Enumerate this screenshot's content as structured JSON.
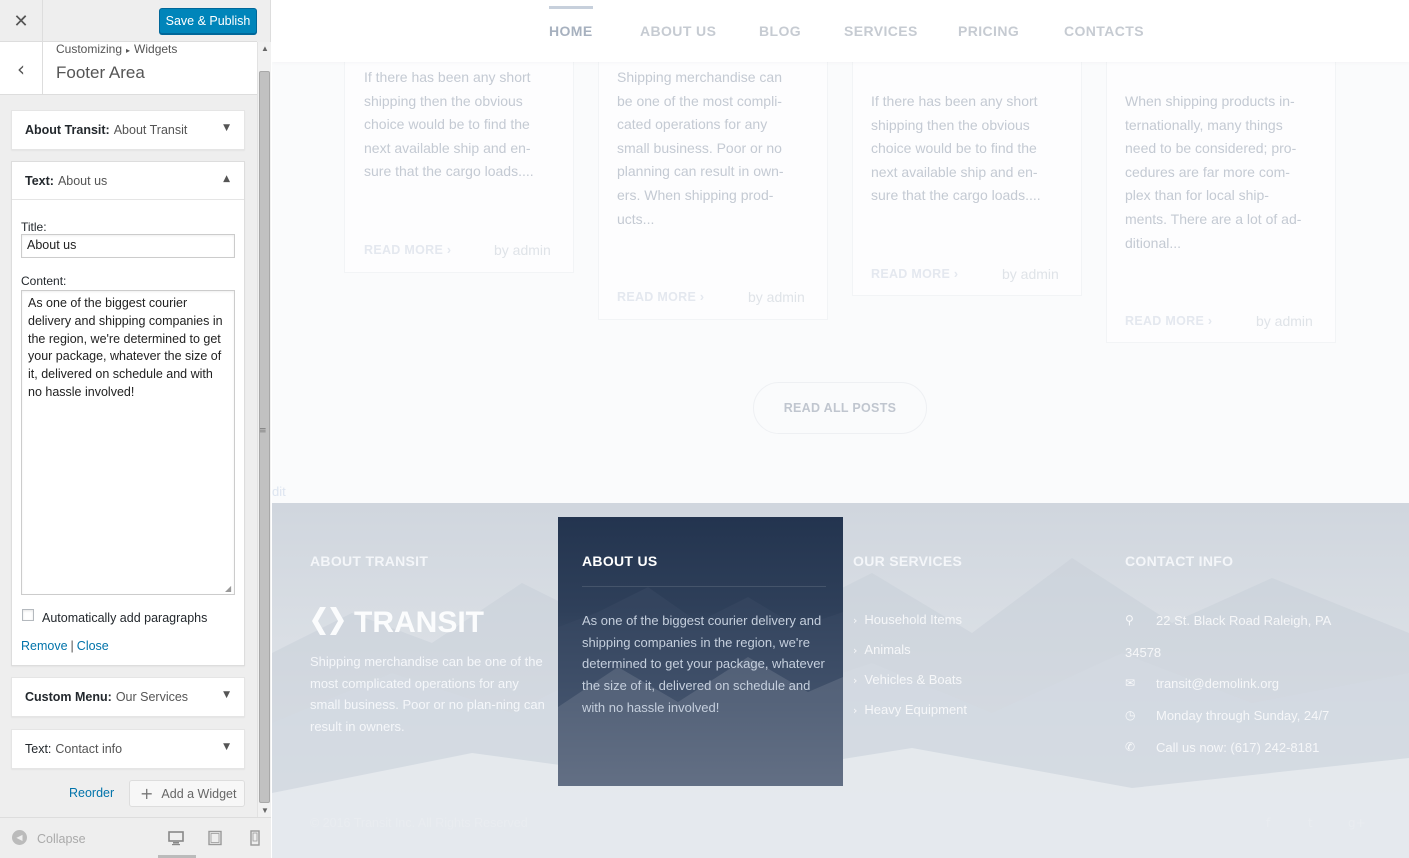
{
  "customizer": {
    "close_icon": "close-icon",
    "save_label": "Save & Publish",
    "breadcrumb": [
      "Customizing",
      "Widgets"
    ],
    "panel_title": "Footer Area",
    "widgets": [
      {
        "type": "About Transit:",
        "title": "About Transit",
        "expanded": false
      },
      {
        "type": "Text:",
        "title": "About us",
        "expanded": true
      },
      {
        "type": "Custom Menu:",
        "title": "Our Services",
        "expanded": false
      },
      {
        "type": "Text:",
        "title": "Contact info",
        "expanded": false
      }
    ],
    "form": {
      "title_label": "Title:",
      "title_value": "About us",
      "content_label": "Content:",
      "content_value": "As one of the biggest courier delivery and shipping companies in the region, we're determined to get your package, whatever the size of it, delivered on schedule and with no hassle involved!",
      "autop_label": "Automatically add paragraphs",
      "autop_checked": false,
      "remove_label": "Remove",
      "close_label": "Close"
    },
    "reorder_label": "Reorder",
    "add_widget_label": "Add a Widget",
    "collapse_label": "Collapse",
    "active_device": "desktop"
  },
  "site": {
    "nav": [
      "HOME",
      "ABOUT US",
      "BLOG",
      "SERVICES",
      "PRICING",
      "CONTACTS"
    ],
    "nav_active": "HOME",
    "posts": [
      {
        "excerpt": [
          "If there has been any short",
          "shipping then the obvious",
          "choice would be to find the",
          "next available ship and en-",
          "sure that the cargo loads...."
        ],
        "read_more": "READ MORE",
        "author": "by admin"
      },
      {
        "excerpt": [
          "Shipping merchandise can",
          "be one of the most compli-",
          "cated operations for any",
          "small business. Poor or no",
          "planning can result in own-",
          "ers. When shipping prod-",
          "ucts..."
        ],
        "read_more": "READ MORE",
        "author": "by admin"
      },
      {
        "excerpt": [
          "If there has been any short",
          "shipping then the obvious",
          "choice would be to find the",
          "next available ship and en-",
          "sure that the cargo loads...."
        ],
        "read_more": "READ MORE",
        "author": "by admin"
      },
      {
        "excerpt": [
          "When shipping products in-",
          "ternationally, many things",
          "need to be considered; pro-",
          "cedures are far more com-",
          "plex than for local ship-",
          "ments. There are a lot of ad-",
          "ditional..."
        ],
        "read_more": "READ MORE",
        "author": "by admin"
      }
    ],
    "read_all_label": "READ ALL POSTS",
    "edit_ghost": "dit",
    "footer": {
      "about_heading": "ABOUT TRANSIT",
      "logo_text": "TRANSIT",
      "about_text": "Shipping merchandise can be one of the most complicated operations for any small business. Poor or no plan-ning can result in owners.",
      "aboutus_heading": "ABOUT US",
      "aboutus_text": "As one of the biggest courier delivery and shipping companies in the region, we're determined to get your package, whatever the size of it, delivered on schedule and with no hassle involved!",
      "services_heading": "OUR SERVICES",
      "services": [
        "Household Items",
        "Animals",
        "Vehicles & Boats",
        "Heavy Equipment"
      ],
      "contact_heading": "CONTACT INFO",
      "contact": {
        "address_line1": "22 St. Black Road Raleigh, PA",
        "address_line2": "34578",
        "email": "transit@demolink.org",
        "hours": "Monday through Sunday, 24/7",
        "phone": "Call us now: (617) 242-8181"
      },
      "copyright": "© 2016 Transit Inc. All Rights Reserved",
      "social": [
        "facebook-icon",
        "twitter-icon",
        "google-plus-icon"
      ]
    }
  }
}
